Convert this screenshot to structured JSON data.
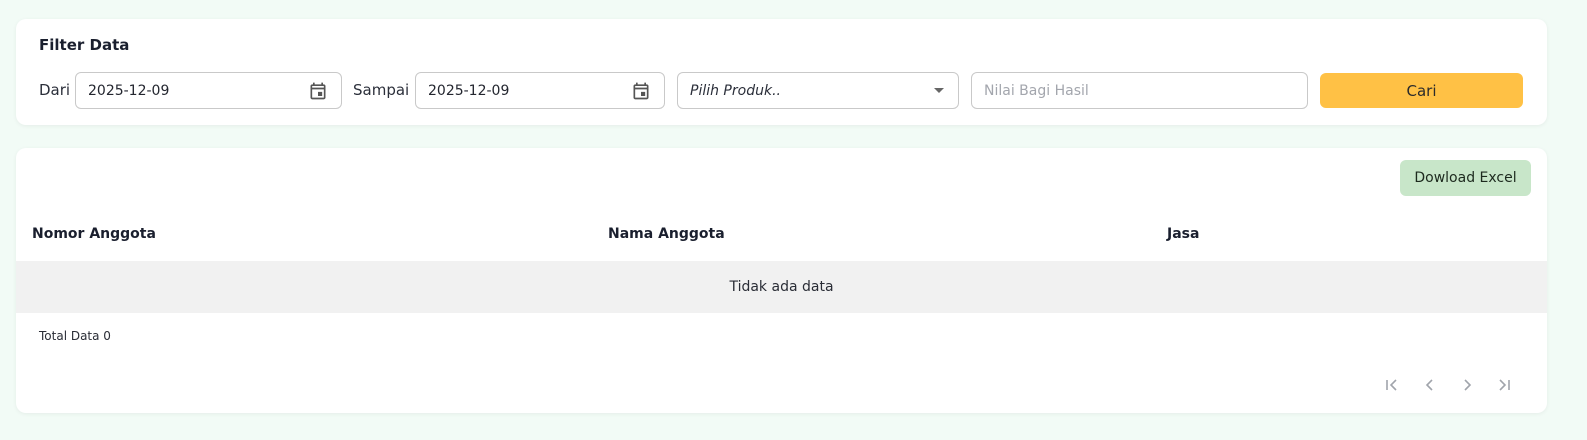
{
  "filter": {
    "title": "Filter Data",
    "from_label": "Dari",
    "from_value": "2025-12-09",
    "to_label": "Sampai",
    "to_value": "2025-12-09",
    "product_placeholder": "Pilih Produk..",
    "share_placeholder": "Nilai Bagi Hasil",
    "search_button": "Cari"
  },
  "table": {
    "download_button": "Dowload Excel",
    "columns": [
      "Nomor Anggota",
      "Nama Anggota",
      "Jasa"
    ],
    "empty_text": "Tidak ada data",
    "total_text": "Total Data 0"
  },
  "colors": {
    "page_background": "#f2fbf6",
    "search_button": "#ffc145",
    "download_button": "#c8e6c9",
    "empty_row": "#f1f1f1"
  },
  "icons": {
    "date_from": "calendar-icon",
    "date_to": "calendar-icon",
    "product": "caret-down-icon",
    "pager": [
      "first-page-icon",
      "previous-page-icon",
      "next-page-icon",
      "last-page-icon"
    ]
  }
}
